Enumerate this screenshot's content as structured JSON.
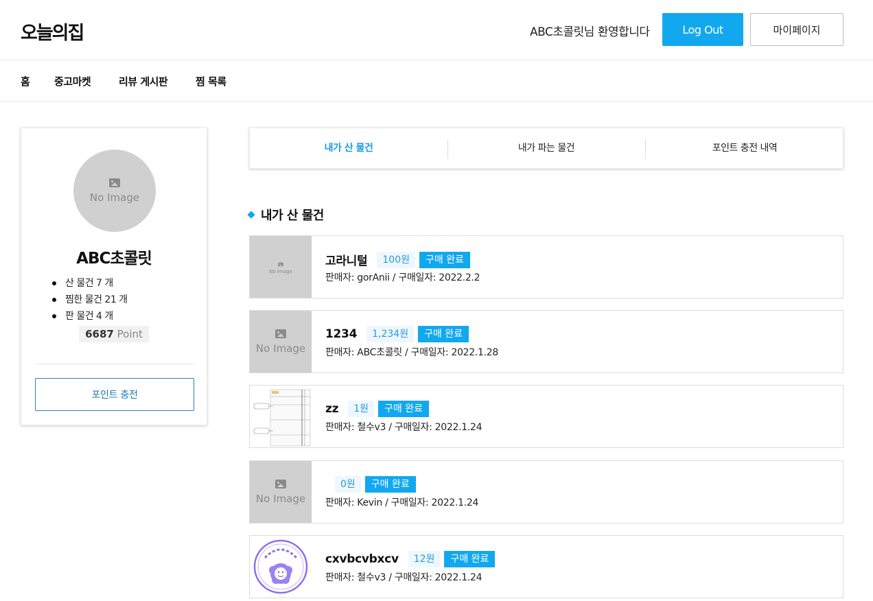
{
  "header": {
    "logo": "오늘의집",
    "welcome": "ABC초콜릿님 환영합니다",
    "logout_label": "Log Out",
    "mypage_label": "마이페이지"
  },
  "nav": {
    "items": [
      {
        "label": "홈"
      },
      {
        "label": "중고마켓"
      },
      {
        "label": "리뷰 게시판"
      },
      {
        "label": "찜 목록"
      }
    ]
  },
  "profile": {
    "avatar_placeholder": "No Image",
    "name": "ABC초콜릿",
    "stats": [
      "산 물건 7 개",
      "찜한 물건 21 개",
      "판 물건 4 개"
    ],
    "point_value": "6687",
    "point_unit": "Point",
    "charge_button_label": "포인트 충전"
  },
  "tabs": [
    {
      "label": "내가 산 물건",
      "active": true
    },
    {
      "label": "내가 파는 물건",
      "active": false
    },
    {
      "label": "포인트 충전 내역",
      "active": false
    }
  ],
  "section_title": "내가 산 물건",
  "items": [
    {
      "name": "고라니털",
      "price": "100원",
      "status": "구매 완료",
      "meta": "판매자: gorAnii / 구매일자: 2022.2.2",
      "thumb": "No Image"
    },
    {
      "name": "1234",
      "price": "1,234원",
      "status": "구매 완료",
      "meta": "판매자: ABC초콜릿 / 구매일자: 2022.1.28",
      "thumb": "No Image"
    },
    {
      "name": "zz",
      "price": "1원",
      "status": "구매 완료",
      "meta": "판매자: 철수v3 / 구매일자: 2022.1.24",
      "thumb": "diagram"
    },
    {
      "name": "",
      "price": "0원",
      "status": "구매 완료",
      "meta": "판매자: Kevin / 구매일자: 2022.1.24",
      "thumb": "No Image"
    },
    {
      "name": "cxvbcvbxcv",
      "price": "12원",
      "status": "구매 완료",
      "meta": "판매자: 철수v3 / 구매일자: 2022.1.24",
      "thumb": "stamp"
    }
  ],
  "colors": {
    "accent": "#12a8ef",
    "active_tab": "#1b9ce0",
    "price_badge_bg": "#eef7fd",
    "placeholder_bg": "#d0d0d0"
  }
}
